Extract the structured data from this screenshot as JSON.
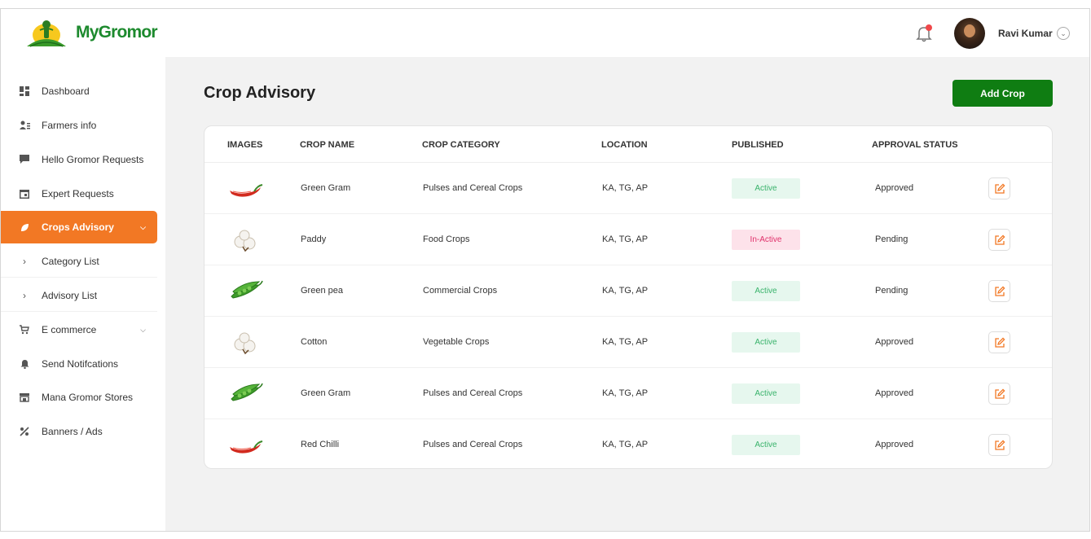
{
  "header": {
    "brand": "MyGromor",
    "user_name": "Ravi Kumar",
    "notification_dot_color": "#f0474a"
  },
  "sidebar": {
    "items": [
      {
        "label": "Dashboard",
        "icon": "dashboard-icon"
      },
      {
        "label": "Farmers info",
        "icon": "users-icon"
      },
      {
        "label": "Hello Gromor Requests",
        "icon": "chat-icon"
      },
      {
        "label": "Expert Requests",
        "icon": "calendar-icon"
      },
      {
        "label": "Crops Advisory",
        "icon": "leaf-icon",
        "active": true
      },
      {
        "label": "Category List",
        "icon": "chevron-right-icon",
        "sub": true
      },
      {
        "label": "Advisory List",
        "icon": "chevron-right-icon",
        "sub": true
      },
      {
        "label": "E commerce",
        "icon": "cart-icon"
      },
      {
        "label": "Send Notifcations",
        "icon": "bell-icon"
      },
      {
        "label": "Mana Gromor Stores",
        "icon": "store-icon"
      },
      {
        "label": "Banners  / Ads",
        "icon": "banner-icon"
      }
    ],
    "active_color": "#f27824"
  },
  "main": {
    "title": "Crop Advisory",
    "add_button": "Add Crop",
    "add_button_color": "#0f7d12"
  },
  "table": {
    "columns": [
      "IMAGES",
      "CROP NAME",
      "CROP CATEGORY",
      "LOCATION",
      "PUBLISHED",
      "APPROVAL STATUS"
    ],
    "rows": [
      {
        "image": "chilli-icon",
        "name": "Green Gram",
        "category": "Pulses and Cereal Crops",
        "location": "KA, TG, AP",
        "published": "Active",
        "status": "Approved"
      },
      {
        "image": "cotton-icon",
        "name": "Paddy",
        "category": "Food Crops",
        "location": "KA, TG, AP",
        "published": "In-Active",
        "status": "Pending"
      },
      {
        "image": "pea-icon",
        "name": "Green pea",
        "category": "Commercial Crops",
        "location": "KA, TG, AP",
        "published": "Active",
        "status": "Pending"
      },
      {
        "image": "cotton-icon",
        "name": "Cotton",
        "category": "Vegetable Crops",
        "location": "KA, TG, AP",
        "published": "Active",
        "status": "Approved"
      },
      {
        "image": "pea-icon",
        "name": "Green Gram",
        "category": "Pulses and Cereal Crops",
        "location": "KA, TG, AP",
        "published": "Active",
        "status": "Approved"
      },
      {
        "image": "chilli-icon",
        "name": "Red Chilli",
        "category": "Pulses and Cereal Crops",
        "location": "KA, TG, AP",
        "published": "Active",
        "status": "Approved"
      }
    ]
  }
}
